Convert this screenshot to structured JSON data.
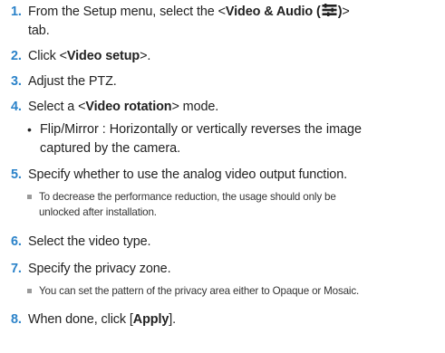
{
  "steps": [
    {
      "num": "1.",
      "pre": "From the Setup menu, select the <",
      "bold": "Video & Audio (",
      "icon": "video-audio-settings-icon",
      "bold2": ")",
      "post": ">",
      "line2": "tab."
    },
    {
      "num": "2.",
      "pre": "Click <",
      "bold": "Video setup",
      "post": ">."
    },
    {
      "num": "3.",
      "text": "Adjust the PTZ."
    },
    {
      "num": "4.",
      "pre": "Select a <",
      "bold": "Video rotation",
      "post": "> mode."
    },
    {
      "num": "5.",
      "text": "Specify whether to use the analog video output function."
    },
    {
      "num": "6.",
      "text": "Select the video type."
    },
    {
      "num": "7.",
      "text": "Specify the privacy zone."
    },
    {
      "num": "8.",
      "pre": "When done, click [",
      "bold": "Apply",
      "post": "]."
    }
  ],
  "bullet": {
    "symbol": "•",
    "line1": "Flip/Mirror : Horizontally or vertically reverses the image",
    "line2": "captured by the camera."
  },
  "notes": [
    {
      "line1": "To decrease the performance reduction, the usage should only be",
      "line2": "unlocked after installation."
    },
    {
      "line1": "You can set the pattern of the privacy area either to Opaque or Mosaic."
    }
  ],
  "colors": {
    "step_number": "#2a82c9",
    "text": "#222222",
    "note_marker": "#9a9a9a"
  }
}
